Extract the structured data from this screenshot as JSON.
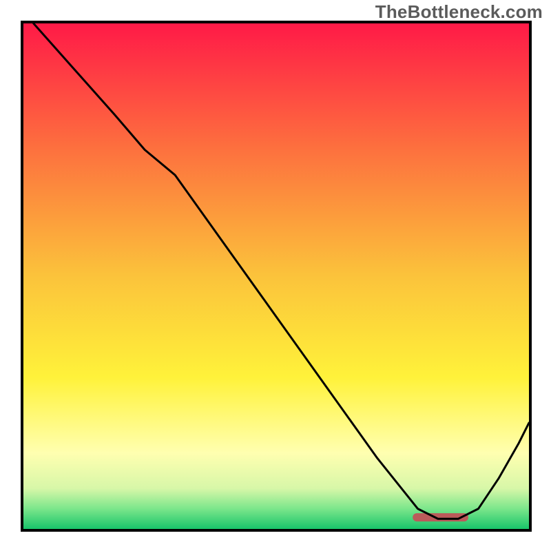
{
  "watermark": "TheBottleneck.com",
  "chart_data": {
    "type": "line",
    "title": "",
    "xlabel": "",
    "ylabel": "",
    "xlim": [
      0,
      100
    ],
    "ylim": [
      0,
      100
    ],
    "grid": false,
    "legend": false,
    "background_gradient_stops": [
      {
        "offset": 0,
        "color": "#ff1a47"
      },
      {
        "offset": 25,
        "color": "#fd713e"
      },
      {
        "offset": 50,
        "color": "#fbc33b"
      },
      {
        "offset": 70,
        "color": "#fff23a"
      },
      {
        "offset": 85,
        "color": "#ffffb0"
      },
      {
        "offset": 92,
        "color": "#d7f7a8"
      },
      {
        "offset": 96,
        "color": "#7be68b"
      },
      {
        "offset": 100,
        "color": "#18c46a"
      }
    ],
    "optimum_band": {
      "x_start": 77,
      "x_end": 88,
      "y": 2.3,
      "color": "#bb5a5a"
    },
    "series": [
      {
        "name": "curve",
        "color": "#000000",
        "width": 3,
        "x": [
          2,
          10,
          18,
          24,
          30,
          40,
          50,
          60,
          70,
          78,
          82,
          86,
          90,
          94,
          98,
          100
        ],
        "y": [
          100,
          91,
          82,
          75,
          70,
          56,
          42,
          28,
          14,
          4,
          2,
          2,
          4,
          10,
          17,
          21
        ]
      }
    ]
  }
}
